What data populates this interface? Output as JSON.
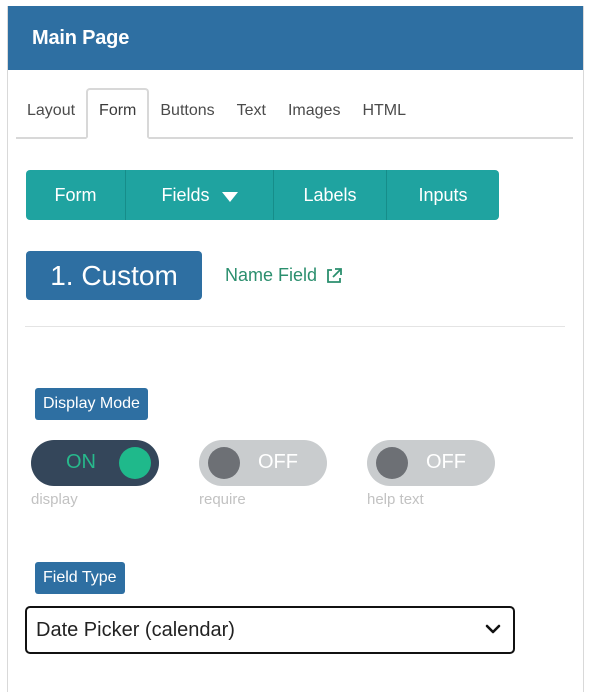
{
  "header": {
    "title": "Main Page"
  },
  "tabs": [
    {
      "label": "Layout"
    },
    {
      "label": "Form"
    },
    {
      "label": "Buttons"
    },
    {
      "label": "Text"
    },
    {
      "label": "Images"
    },
    {
      "label": "HTML"
    }
  ],
  "active_tab": "Form",
  "subnav": {
    "items": [
      {
        "label": "Form"
      },
      {
        "label": "Fields"
      },
      {
        "label": "Labels"
      },
      {
        "label": "Inputs"
      }
    ]
  },
  "field": {
    "badge": "1. Custom",
    "link_label": "Name Field"
  },
  "display_mode": {
    "label": "Display Mode",
    "toggles": [
      {
        "state": "ON",
        "caption": "display"
      },
      {
        "state": "OFF",
        "caption": "require"
      },
      {
        "state": "OFF",
        "caption": "help text"
      }
    ]
  },
  "field_type": {
    "label": "Field Type",
    "selected": "Date Picker (calendar)"
  },
  "colors": {
    "primary_blue": "#2e6fa2",
    "teal": "#1fa3a0",
    "toggle_on_bg": "#34465a",
    "toggle_on_knob": "#1fb98b",
    "toggle_off_bg": "#c9ccce",
    "link_green": "#2b8f6e"
  },
  "icons": [
    "external-link-icon",
    "caret-down-icon",
    "chevron-down-icon"
  ]
}
